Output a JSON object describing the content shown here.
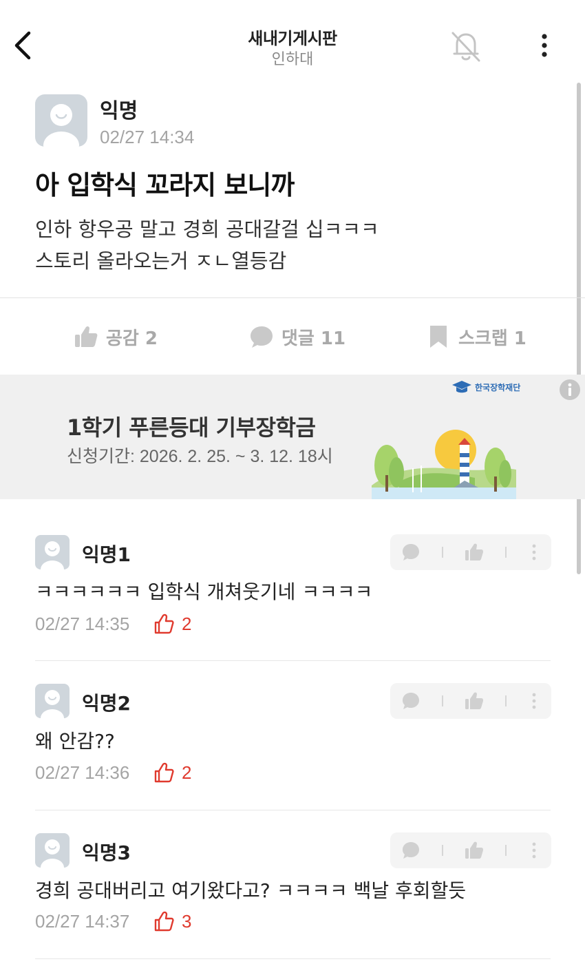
{
  "header": {
    "back_icon": "chevron-left-icon",
    "title": "새내기게시판",
    "subtitle": "인하대",
    "bell_icon": "bell-off-icon",
    "more_icon": "more-vertical-icon"
  },
  "post": {
    "author": "익명",
    "time": "02/27 14:34",
    "title": "아 입학식 꼬라지 보니까",
    "body": "인하 항우공 말고 경희 공대갈걸 십ㅋㅋㅋ\n스토리 올라오는거 ㅈㄴ열등감",
    "actions": {
      "like_label": "공감 2",
      "comment_label": "댓글 11",
      "scrap_label": "스크랩 1"
    }
  },
  "banner": {
    "title": "1학기 푸른등대 기부장학금",
    "subtitle": "신청기간: 2026. 2. 25. ~ 3. 12. 18시",
    "logo_text": "한국장학재단"
  },
  "comments": [
    {
      "author": "익명1",
      "text": "ㅋㅋㅋㅋㅋㅋ 입학식 개쳐웃기네 ㅋㅋㅋㅋ",
      "time": "02/27 14:35",
      "likes": "2"
    },
    {
      "author": "익명2",
      "text": "왜 안감??",
      "time": "02/27 14:36",
      "likes": "2"
    },
    {
      "author": "익명3",
      "text": "경희 공대버리고 여기왔다고? ㅋㅋㅋㅋ 백날 후회할듯",
      "time": "02/27 14:37",
      "likes": "3"
    }
  ],
  "colors": {
    "accent_like": "#e03a2e",
    "muted": "#a4a4a4",
    "banner_bg": "#f0f0f0",
    "avatar_bg": "#cfd6dc"
  }
}
